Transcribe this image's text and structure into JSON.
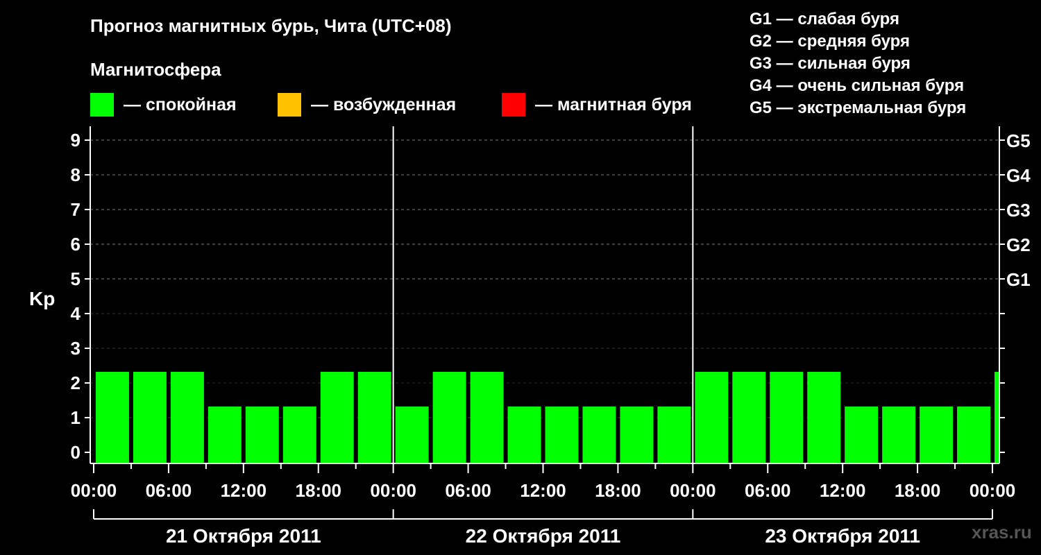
{
  "header": {
    "title": "Прогноз магнитных бурь, Чита (UTC+08)",
    "subtitle": "Магнитосфера"
  },
  "legend": [
    {
      "color": "#00ff00",
      "label": "— спокойная"
    },
    {
      "color": "#ffc000",
      "label": "— возбужденная"
    },
    {
      "color": "#ff0000",
      "label": "— магнитная буря"
    }
  ],
  "g_legend": [
    "G1 — слабая буря",
    "G2 — средняя буря",
    "G3 — сильная буря",
    "G4 — очень сильная буря",
    "G5 — экстремальная буря"
  ],
  "watermark": "xras.ru",
  "chart_data": {
    "type": "bar",
    "ylabel": "Kp",
    "ylim": [
      0,
      9
    ],
    "y_ticks": [
      "0",
      "1",
      "2",
      "3",
      "4",
      "5",
      "6",
      "7",
      "8",
      "9"
    ],
    "right_ticks": [
      {
        "value": 5,
        "label": "G1"
      },
      {
        "value": 6,
        "label": "G2"
      },
      {
        "value": 7,
        "label": "G3"
      },
      {
        "value": 8,
        "label": "G4"
      },
      {
        "value": 9,
        "label": "G5"
      }
    ],
    "x_tick_labels": [
      "00:00",
      "06:00",
      "12:00",
      "18:00",
      "00:00",
      "06:00",
      "12:00",
      "18:00",
      "00:00",
      "06:00",
      "12:00",
      "18:00",
      "00:00"
    ],
    "days": [
      "21 Октября 2011",
      "22 Октября 2011",
      "23 Октября 2011"
    ],
    "grid": true,
    "values": [
      2,
      2,
      2,
      1,
      1,
      1,
      2,
      2,
      1,
      2,
      2,
      1,
      1,
      1,
      1,
      1,
      2,
      2,
      2,
      2,
      1,
      1,
      1,
      1,
      2
    ],
    "bar_colors": [
      "#00ff00"
    ]
  }
}
